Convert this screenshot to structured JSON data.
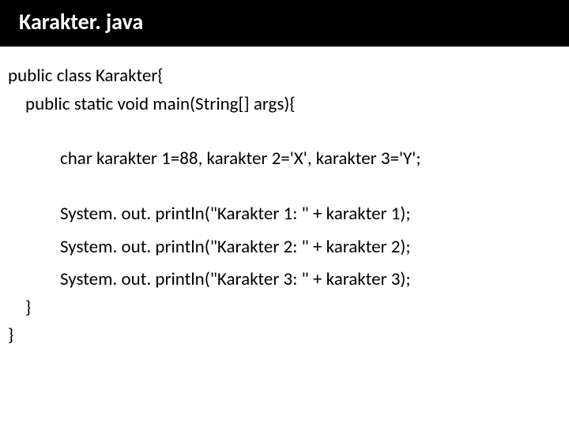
{
  "header": {
    "title": "Karakter. java"
  },
  "code": {
    "line1": "public class Karakter{",
    "line2": "public static void main(String[] args){",
    "line3": "char karakter 1=88, karakter 2='X', karakter 3='Y';",
    "line4": "System. out. println(\"Karakter 1: \" + karakter 1);",
    "line5": "System. out. println(\"Karakter 2: \" + karakter 2);",
    "line6": "System. out. println(\"Karakter 3: \" + karakter 3);",
    "line7": "}",
    "line8": "}"
  }
}
